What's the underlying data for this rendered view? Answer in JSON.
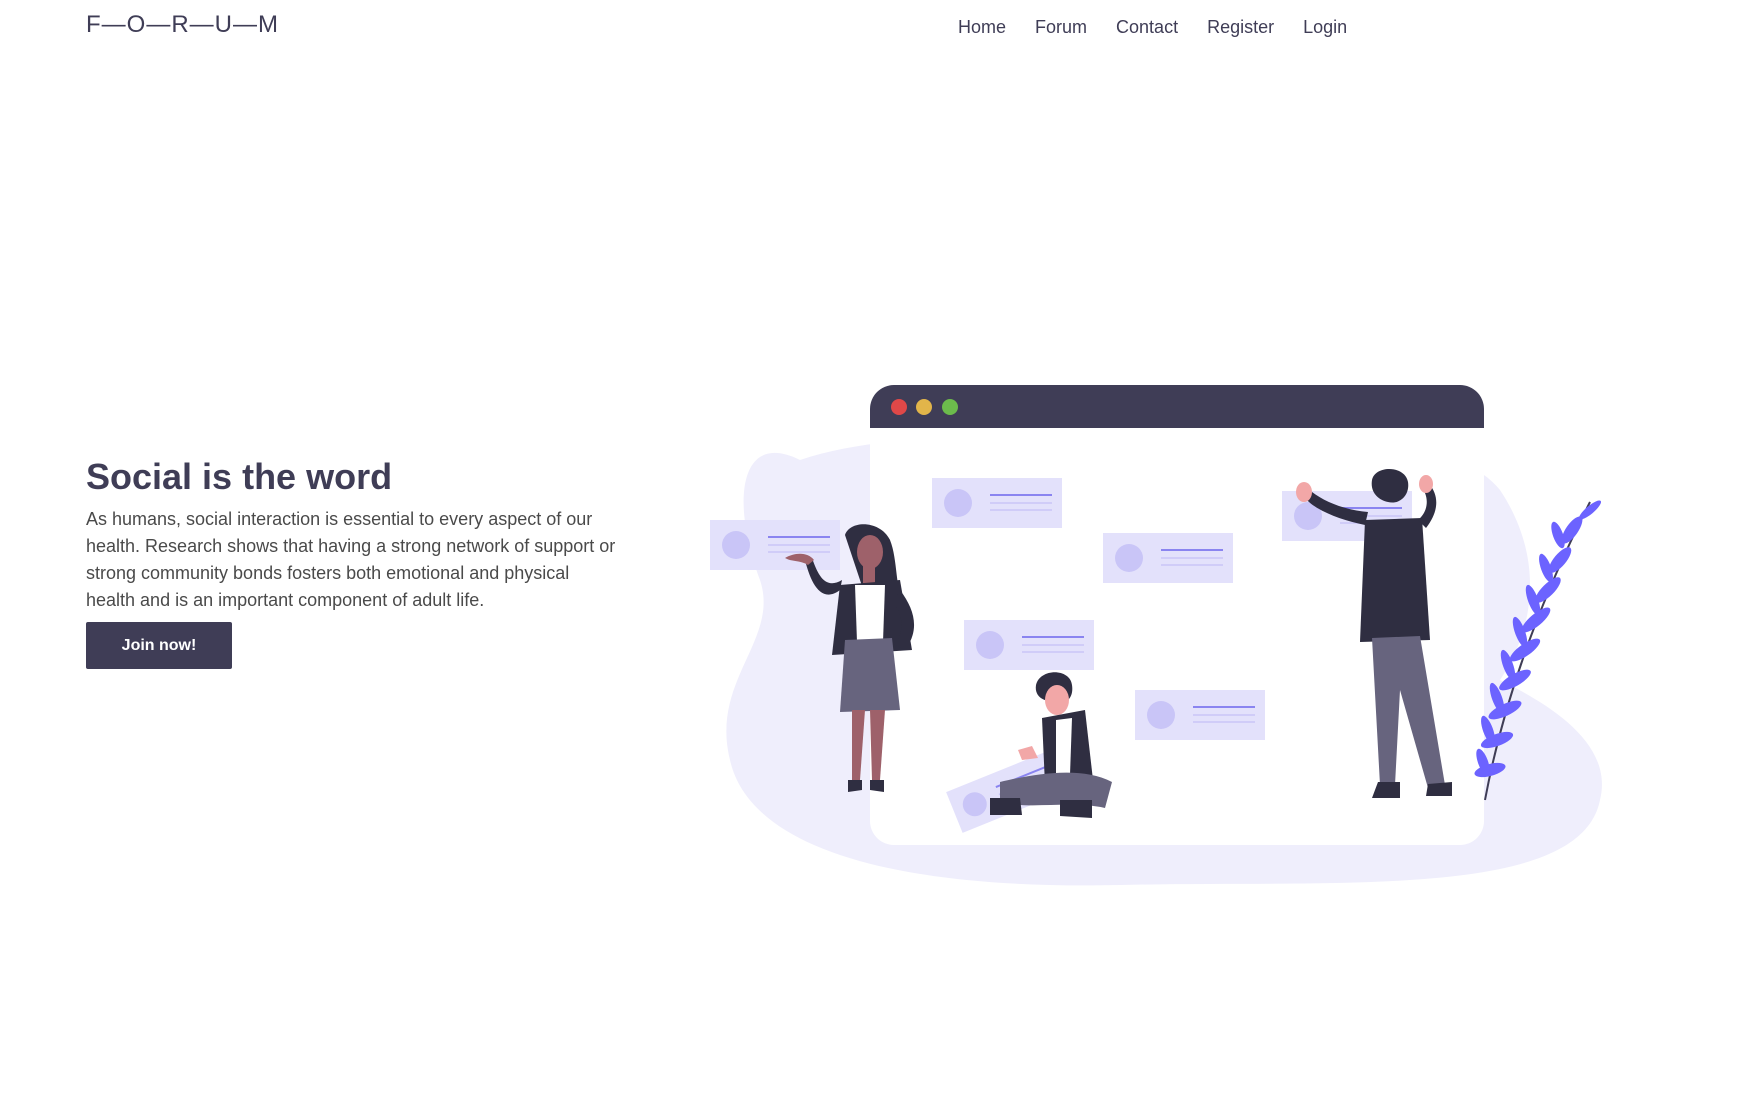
{
  "header": {
    "brand": "F—O—R—U—M",
    "nav": [
      "Home",
      "Forum",
      "Contact",
      "Register",
      "Login"
    ]
  },
  "hero": {
    "title": "Social is the word",
    "text": "As humans, social interaction is essential to every aspect of our health. Research shows that having a strong network of support or strong community bonds fosters both emotional and physical health and is an important component of adult life.",
    "cta": "Join now!"
  },
  "colors": {
    "primary": "#3f3d56",
    "accent": "#6c63ff",
    "blob": "#efeefc",
    "card": "#e3e1fb"
  },
  "illustration": {
    "icon": "people-social-network-illustration"
  }
}
